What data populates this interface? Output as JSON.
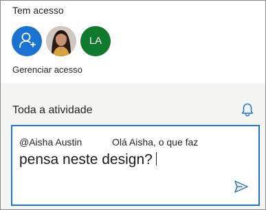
{
  "access": {
    "title": "Tem acesso",
    "avatars": [
      {
        "name": "add-person",
        "icon": "person-add-icon",
        "color": "#1a73d0"
      },
      {
        "name": "photo"
      },
      {
        "name": "initials",
        "text": "LA",
        "color": "#0f7a2c"
      }
    ],
    "manage_label": "Gerenciar acesso"
  },
  "activity": {
    "title": "Toda a atividade",
    "bell_icon": "bell-icon",
    "comment": {
      "mention": "@Aisha Austin",
      "line1": "Olá Aisha, o que faz",
      "line2": "pensa neste design?"
    },
    "send_icon": "send-icon"
  },
  "colors": {
    "accent": "#1f73c8",
    "panel_bg": "#f4f4f3"
  }
}
